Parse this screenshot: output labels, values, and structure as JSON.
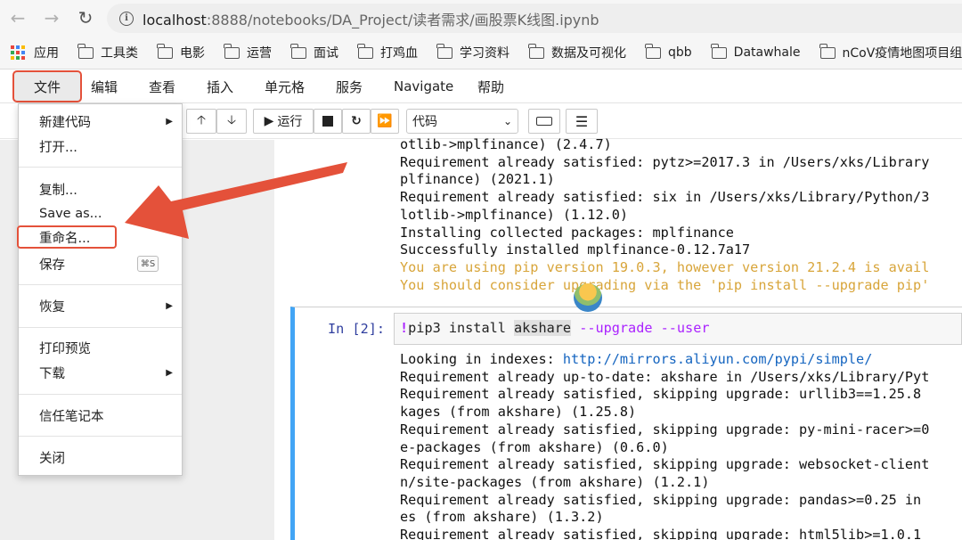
{
  "browser": {
    "url_host": "localhost",
    "url_rest": ":8888/notebooks/DA_Project/读者需求/画股票K线图.ipynb",
    "bookmarks": [
      "应用",
      "工具类",
      "电影",
      "运营",
      "面试",
      "打鸡血",
      "学习资料",
      "数据及可视化",
      "qbb",
      "Datawhale",
      "nCoV疫情地图项目组"
    ]
  },
  "menubar": {
    "items": [
      "文件",
      "编辑",
      "查看",
      "插入",
      "单元格",
      "服务",
      "Navigate",
      "帮助"
    ]
  },
  "toolbar": {
    "run_label": "运行",
    "cell_type": "代码"
  },
  "file_menu": {
    "new": "新建代码",
    "open": "打开...",
    "copy": "复制...",
    "save_as": "Save as...",
    "rename": "重命名...",
    "save": "保存",
    "save_shortcut": "⌘S",
    "restore": "恢复",
    "print_preview": "打印预览",
    "download": "下载",
    "trust": "信任笔记本",
    "close": "关闭"
  },
  "cell1_output": [
    "otlib->mplfinance) (2.4.7)",
    "Requirement already satisfied: pytz>=2017.3 in /Users/xks/Library",
    "plfinance) (2021.1)",
    "Requirement already satisfied: six in /Users/xks/Library/Python/3",
    "lotlib->mplfinance) (1.12.0)",
    "Installing collected packages: mplfinance",
    "Successfully installed mplfinance-0.12.7a17"
  ],
  "cell1_warnings": [
    "You are using pip version 19.0.3, however version 21.2.4 is avail",
    "You should consider upgrading via the 'pip install --upgrade pip'"
  ],
  "cell2": {
    "prompt": "In [2]:",
    "code_bang": "!",
    "code_cmd": "pip3 install ",
    "code_pkg": "akshare",
    "code_flag1": " --upgrade",
    "code_flag2": " --user"
  },
  "cell2_output": {
    "line1_prefix": "Looking in indexes: ",
    "line1_link": "http://mirrors.aliyun.com/pypi/simple/",
    "lines": [
      "Requirement already up-to-date: akshare in /Users/xks/Library/Pyt",
      "Requirement already satisfied, skipping upgrade: urllib3==1.25.8",
      "kages (from akshare) (1.25.8)",
      "Requirement already satisfied, skipping upgrade: py-mini-racer>=0",
      "e-packages (from akshare) (0.6.0)",
      "Requirement already satisfied, skipping upgrade: websocket-client",
      "n/site-packages (from akshare) (1.2.1)",
      "Requirement already satisfied, skipping upgrade: pandas>=0.25 in",
      "es (from akshare) (1.3.2)",
      "Requirement already satisfied, skipping upgrade: html5lib>=1.0.1"
    ]
  }
}
